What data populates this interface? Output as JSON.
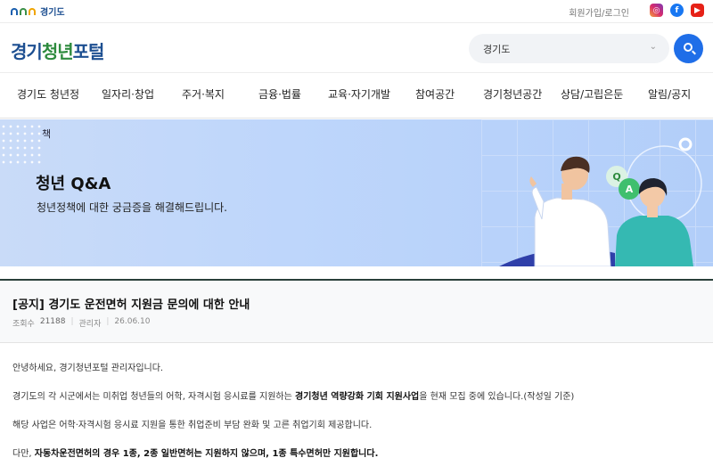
{
  "topbar": {
    "gov_logo_text": "경기도",
    "auth_link": "회원가입/로그인",
    "sns": [
      {
        "name": "instagram",
        "glyph": "◎"
      },
      {
        "name": "facebook",
        "glyph": "f"
      },
      {
        "name": "youtube",
        "glyph": "▶"
      }
    ]
  },
  "header": {
    "brand_1": "경기",
    "brand_2": "청년",
    "brand_3": "포털",
    "search_value": "경기도",
    "search_chevron": "⌄"
  },
  "nav": {
    "items": [
      "경기도 청년정",
      "일자리·창업",
      "주거·복지",
      "금융·법률",
      "교육·자기개발",
      "참여공간",
      "경기청년공간",
      "상담/고립은둔",
      "알림/공지"
    ]
  },
  "banner": {
    "cut_text": "책",
    "title": "청년 Q&A",
    "subtitle": "청년정책에 대한 궁금증을 해결해드립니다.",
    "bubble_q": "Q",
    "bubble_a": "A"
  },
  "notice": {
    "title": "[공지]  경기도 운전면허 지원금 문의에 대한 안내",
    "views_label": "조회수",
    "views": "21188",
    "author": "관리자",
    "date": "26.06.10"
  },
  "body": {
    "p1": "안녕하세요, 경기청년포털 관리자입니다.",
    "p2_a": "경기도의 각 시군에서는 미취업 청년들의 어학, 자격시험 응시료를 지원하는 ",
    "p2_b": "경기청년 역량강화 기회 지원사업",
    "p2_c": "을 현재 모집 중에 있습니다.(작성일 기준)",
    "p3": "해당 사업은 어학·자격시험 응시료 지원을 통한 취업준비 부담 완화 및 고른 취업기회 제공합니다.",
    "p4_a": "다만, ",
    "p4_b": "자동차운전면허의 경우 1종, 2종 일반면허는 지원하지 않으며, 1종 특수면허만 지원합니다."
  },
  "colors": {
    "accent_blue": "#1f6ee8",
    "brand_navy": "#1d4f91",
    "brand_green": "#2e8b3e",
    "banner_bg": "#bed6fb",
    "notice_border": "#2a3f3a"
  }
}
